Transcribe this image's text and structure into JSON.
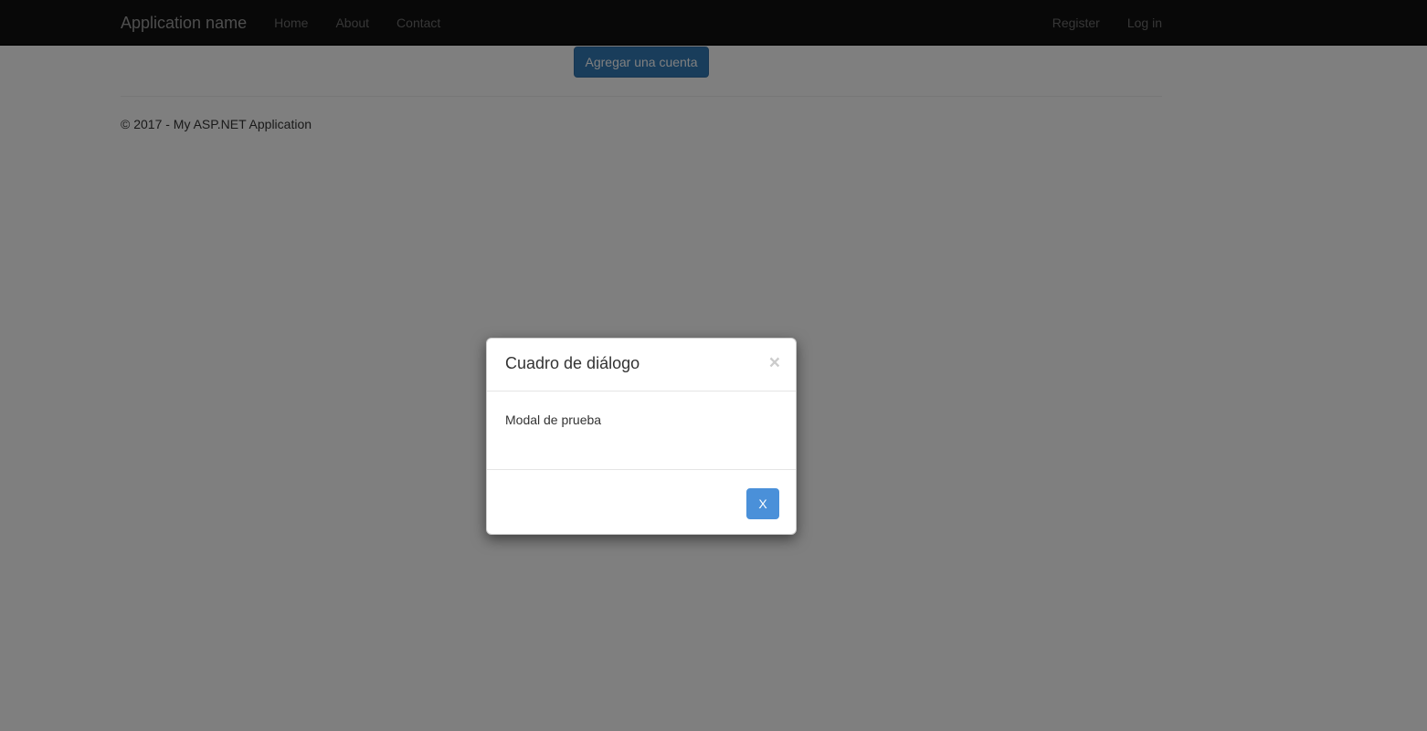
{
  "navbar": {
    "brand": "Application name",
    "left_links": [
      {
        "label": "Home"
      },
      {
        "label": "About"
      },
      {
        "label": "Contact"
      }
    ],
    "right_links": [
      {
        "label": "Register"
      },
      {
        "label": "Log in"
      }
    ],
    "background_color": "#101010",
    "brand_color": "#9d9d9d",
    "link_color": "#6f6f6f"
  },
  "main": {
    "add_account_button": "Agregar una cuenta",
    "add_account_button_color": "#337ab7"
  },
  "footer": {
    "copyright": "© 2017 - My ASP.NET Application"
  },
  "modal": {
    "title": "Cuadro de diálogo",
    "close_icon": "×",
    "body_text": "Modal de prueba",
    "footer_button": "X",
    "footer_button_color": "#4a90d9",
    "backdrop_color": "#000000",
    "backdrop_opacity": "0.5"
  }
}
